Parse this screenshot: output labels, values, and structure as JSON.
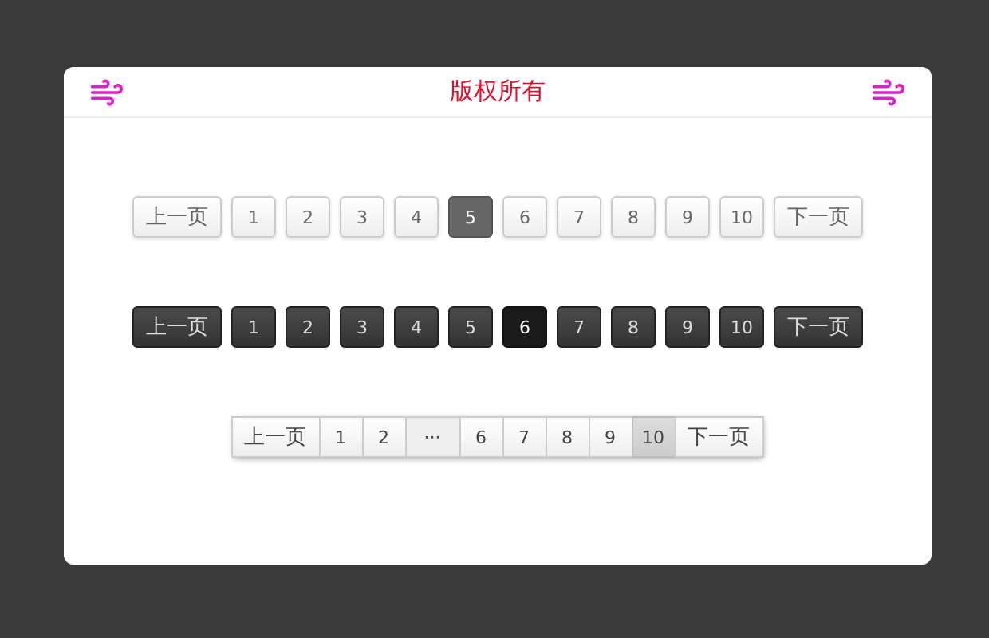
{
  "header": {
    "title": "版权所有"
  },
  "pagers": [
    {
      "kind": "light",
      "items": [
        {
          "label": "上一页",
          "kind": "nav",
          "selected": false
        },
        {
          "label": "1",
          "kind": "page",
          "selected": false
        },
        {
          "label": "2",
          "kind": "page",
          "selected": false
        },
        {
          "label": "3",
          "kind": "page",
          "selected": false
        },
        {
          "label": "4",
          "kind": "page",
          "selected": false
        },
        {
          "label": "5",
          "kind": "page",
          "selected": true
        },
        {
          "label": "6",
          "kind": "page",
          "selected": false
        },
        {
          "label": "7",
          "kind": "page",
          "selected": false
        },
        {
          "label": "8",
          "kind": "page",
          "selected": false
        },
        {
          "label": "9",
          "kind": "page",
          "selected": false
        },
        {
          "label": "10",
          "kind": "page",
          "selected": false
        },
        {
          "label": "下一页",
          "kind": "nav",
          "selected": false
        }
      ]
    },
    {
      "kind": "dark",
      "items": [
        {
          "label": "上一页",
          "kind": "nav",
          "selected": false
        },
        {
          "label": "1",
          "kind": "page",
          "selected": false
        },
        {
          "label": "2",
          "kind": "page",
          "selected": false
        },
        {
          "label": "3",
          "kind": "page",
          "selected": false
        },
        {
          "label": "4",
          "kind": "page",
          "selected": false
        },
        {
          "label": "5",
          "kind": "page",
          "selected": false
        },
        {
          "label": "6",
          "kind": "page",
          "selected": true
        },
        {
          "label": "7",
          "kind": "page",
          "selected": false
        },
        {
          "label": "8",
          "kind": "page",
          "selected": false
        },
        {
          "label": "9",
          "kind": "page",
          "selected": false
        },
        {
          "label": "10",
          "kind": "page",
          "selected": false
        },
        {
          "label": "下一页",
          "kind": "nav",
          "selected": false
        }
      ]
    },
    {
      "kind": "joined",
      "items": [
        {
          "label": "上一页",
          "kind": "nav",
          "selected": false
        },
        {
          "label": "1",
          "kind": "page",
          "selected": false
        },
        {
          "label": "2",
          "kind": "page",
          "selected": false
        },
        {
          "label": "···",
          "kind": "ellipsis",
          "selected": false
        },
        {
          "label": "6",
          "kind": "page",
          "selected": false
        },
        {
          "label": "7",
          "kind": "page",
          "selected": false
        },
        {
          "label": "8",
          "kind": "page",
          "selected": false
        },
        {
          "label": "9",
          "kind": "page",
          "selected": false
        },
        {
          "label": "10",
          "kind": "page",
          "selected": true
        },
        {
          "label": "下一页",
          "kind": "nav",
          "selected": false
        }
      ]
    }
  ]
}
